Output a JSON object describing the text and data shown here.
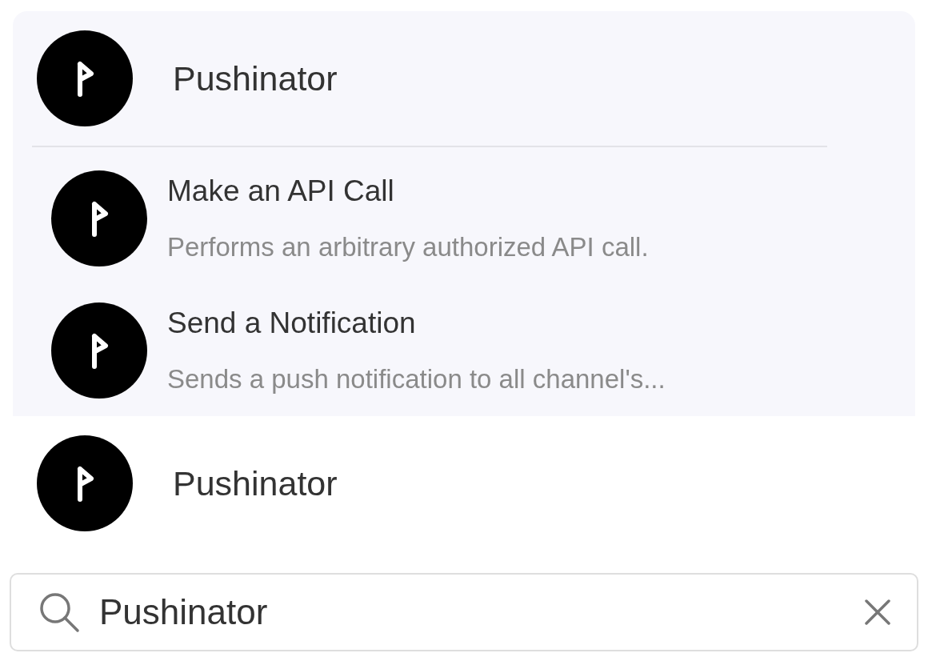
{
  "apps": [
    {
      "name": "Pushinator",
      "expanded": true,
      "actions": [
        {
          "title": "Make an API Call",
          "description": "Performs an arbitrary authorized API call."
        },
        {
          "title": "Send a Notification",
          "description": "Sends a push notification to all channel's..."
        }
      ]
    },
    {
      "name": "Pushinator",
      "expanded": false
    }
  ],
  "search": {
    "value": "Pushinator"
  }
}
